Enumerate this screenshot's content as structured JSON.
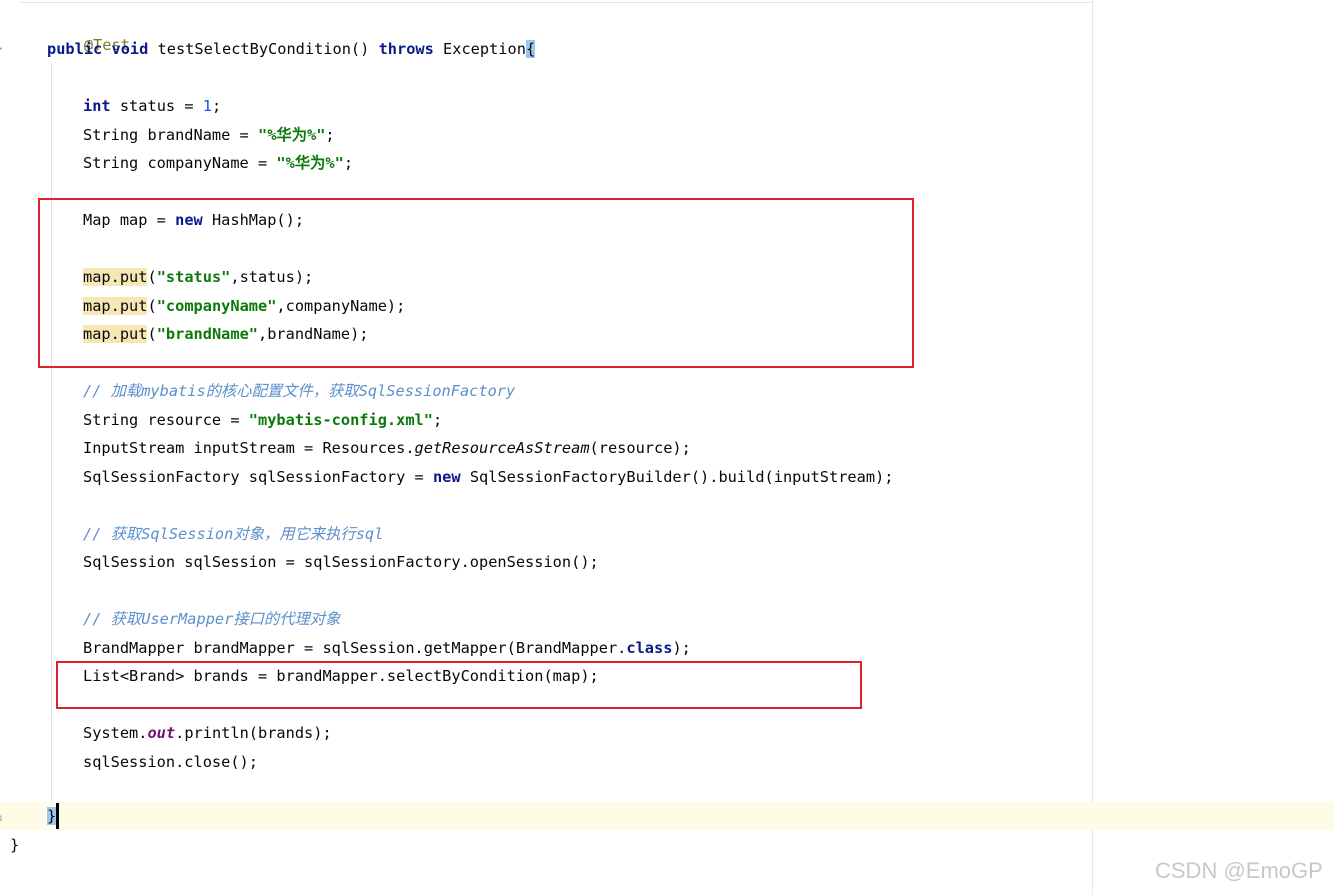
{
  "editor": {
    "code": {
      "annotation": "@Test",
      "method_kw1": "public",
      "method_kw2": "void",
      "method_name": " testSelectByCondition() ",
      "method_throws": "throws",
      "method_exc": " Exception",
      "method_brace": "{",
      "l_status_kw": "int",
      "l_status_rest": " status = ",
      "l_status_num": "1",
      "l_status_end": ";",
      "l_brand_pre": "String brandName = ",
      "l_brand_str": "\"%华为%\"",
      "l_brand_end": ";",
      "l_company_pre": "String companyName = ",
      "l_company_str": "\"%华为%\"",
      "l_company_end": ";",
      "l_map_pre": "Map map = ",
      "l_map_kw": "new",
      "l_map_end": " HashMap();",
      "put_prefix": "map.put",
      "put1_open": "(",
      "put1_str": "\"status\"",
      "put1_end": ",status);",
      "put2_open": "(",
      "put2_str": "\"companyName\"",
      "put2_end": ",companyName);",
      "put3_open": "(",
      "put3_str": "\"brandName\"",
      "put3_end": ",brandName);",
      "cmt1": "// 加载mybatis的核心配置文件，获取SqlSessionFactory",
      "l_res_pre": "String resource = ",
      "l_res_str": "\"mybatis-config.xml\"",
      "l_res_end": ";",
      "l_is_pre": "InputStream inputStream = Resources.",
      "l_is_ital": "getResourceAsStream",
      "l_is_end": "(resource);",
      "l_ssf_pre": "SqlSessionFactory sqlSessionFactory = ",
      "l_ssf_kw": "new",
      "l_ssf_end": " SqlSessionFactoryBuilder().build(inputStream);",
      "cmt2": "// 获取SqlSession对象，用它来执行sql",
      "l_ss": "SqlSession sqlSession = sqlSessionFactory.openSession();",
      "cmt3": "// 获取UserMapper接口的代理对象",
      "l_bm_pre": "BrandMapper brandMapper = sqlSession.getMapper(BrandMapper.",
      "l_bm_kw": "class",
      "l_bm_end": ");",
      "l_list": "List<Brand> brands = brandMapper.selectByCondition(map);",
      "l_sys_pre": "System.",
      "l_sys_out": "out",
      "l_sys_end": ".println(brands);",
      "l_close": "sqlSession.close();",
      "close_method": "}",
      "close_class": "}"
    },
    "colors": {
      "keyword": "#0a1a8a",
      "string": "#0b7a0b",
      "comment": "#5c8fcc",
      "annotation": "#7a7a22",
      "highlight_box": "#e0222c"
    }
  },
  "watermark": "CSDN @EmoGP"
}
